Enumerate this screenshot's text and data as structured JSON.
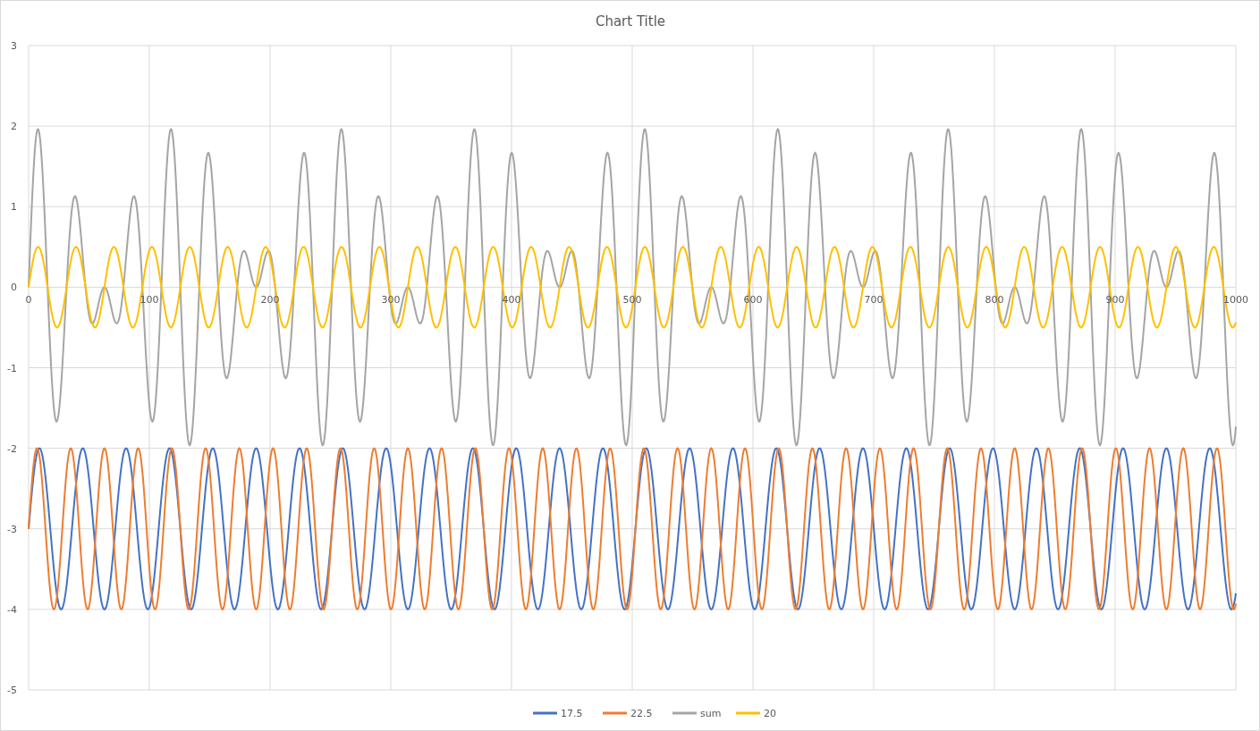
{
  "chart": {
    "title": "Chart Title",
    "y_axis_labels": [
      "3",
      "2",
      "1",
      "0",
      "-1",
      "-2",
      "-3",
      "-4",
      "-5"
    ],
    "x_axis_labels": [
      "0",
      "100",
      "200",
      "300",
      "400",
      "500",
      "600",
      "700",
      "800",
      "900",
      "1000"
    ],
    "legend": [
      {
        "name": "17.5",
        "color": "#4472c4"
      },
      {
        "name": "22.5",
        "color": "#ed7d31"
      },
      {
        "name": "sum",
        "color": "#a5a5a5"
      },
      {
        "name": "20",
        "color": "#ffc000"
      }
    ]
  }
}
